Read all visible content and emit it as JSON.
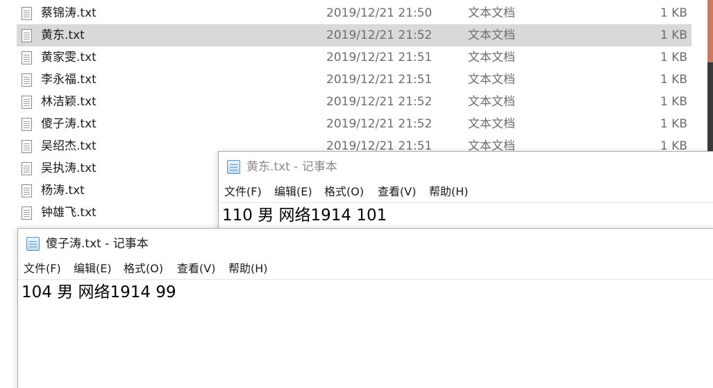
{
  "explorer": {
    "files": [
      {
        "name": "蔡锦涛.txt",
        "date": "2019/12/21 21:50",
        "type": "文本文档",
        "size": "1 KB",
        "selected": false
      },
      {
        "name": "黄东.txt",
        "date": "2019/12/21 21:52",
        "type": "文本文档",
        "size": "1 KB",
        "selected": true
      },
      {
        "name": "黄家雯.txt",
        "date": "2019/12/21 21:51",
        "type": "文本文档",
        "size": "1 KB",
        "selected": false
      },
      {
        "name": "李永福.txt",
        "date": "2019/12/21 21:51",
        "type": "文本文档",
        "size": "1 KB",
        "selected": false
      },
      {
        "name": "林洁颖.txt",
        "date": "2019/12/21 21:52",
        "type": "文本文档",
        "size": "1 KB",
        "selected": false
      },
      {
        "name": "傻子涛.txt",
        "date": "2019/12/21 21:52",
        "type": "文本文档",
        "size": "1 KB",
        "selected": false
      },
      {
        "name": "吴绍杰.txt",
        "date": "2019/12/21 21:51",
        "type": "文本文档",
        "size": "1 KB",
        "selected": false
      },
      {
        "name": "吴执涛.txt",
        "date": "",
        "type": "",
        "size": "",
        "selected": false
      },
      {
        "name": "杨涛.txt",
        "date": "",
        "type": "",
        "size": "",
        "selected": false
      },
      {
        "name": "钟雄飞.txt",
        "date": "",
        "type": "",
        "size": "",
        "selected": false
      }
    ]
  },
  "notepad_back": {
    "title": "黄东.txt - 记事本",
    "menu": [
      "文件(F)",
      "编辑(E)",
      "格式(O)",
      "查看(V)",
      "帮助(H)"
    ],
    "content": "110 男 网络1914 101"
  },
  "notepad_front": {
    "title": "傻子涛.txt - 记事本",
    "menu": [
      "文件(F)",
      "编辑(E)",
      "格式(O)",
      "查看(V)",
      "帮助(H)"
    ],
    "content": "104 男 网络1914 99"
  },
  "icons": {
    "file_icon": "text-file-icon",
    "notepad_icon": "notepad-icon"
  }
}
